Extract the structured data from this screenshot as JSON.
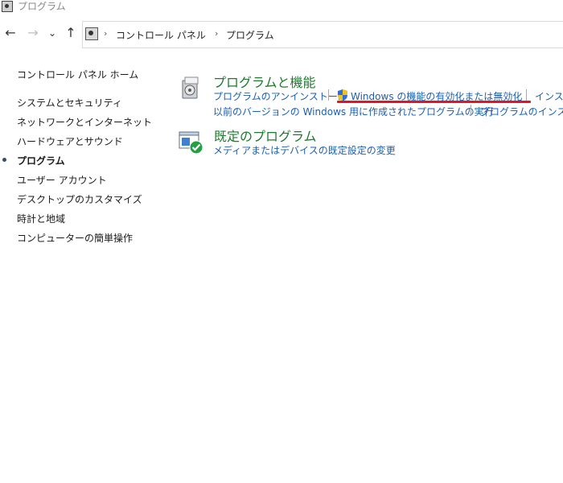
{
  "window": {
    "title": "プログラム"
  },
  "nav": {
    "back_icon": "←",
    "forward_icon": "→",
    "recent_icon": "⌄",
    "up_icon": "↑"
  },
  "breadcrumb": {
    "sep": "›",
    "items": [
      "コントロール パネル",
      "プログラム"
    ]
  },
  "sidebar": {
    "items": [
      {
        "label": "コントロール パネル ホーム"
      },
      {
        "label": "システムとセキュリティ"
      },
      {
        "label": "ネットワークとインターネット"
      },
      {
        "label": "ハードウェアとサウンド"
      },
      {
        "label": "プログラム"
      },
      {
        "label": "ユーザー アカウント"
      },
      {
        "label": "デスクトップのカスタマイズ"
      },
      {
        "label": "時計と地域"
      },
      {
        "label": "コンピューターの簡単操作"
      }
    ]
  },
  "programs_features": {
    "title": "プログラムと機能",
    "links": [
      "プログラムのアンインストール",
      "Windows の機能の有効化または無効化",
      "インスト",
      "以前のバージョンの Windows 用に作成されたプログラムの実行",
      "プログラムのインストー"
    ]
  },
  "default_programs": {
    "title": "既定のプログラム",
    "links": [
      "メディアまたはデバイスの既定設定の変更"
    ]
  },
  "colors": {
    "section_title": "#1e7a2e",
    "link": "#1a5fb4",
    "highlight": "#e0142b"
  }
}
